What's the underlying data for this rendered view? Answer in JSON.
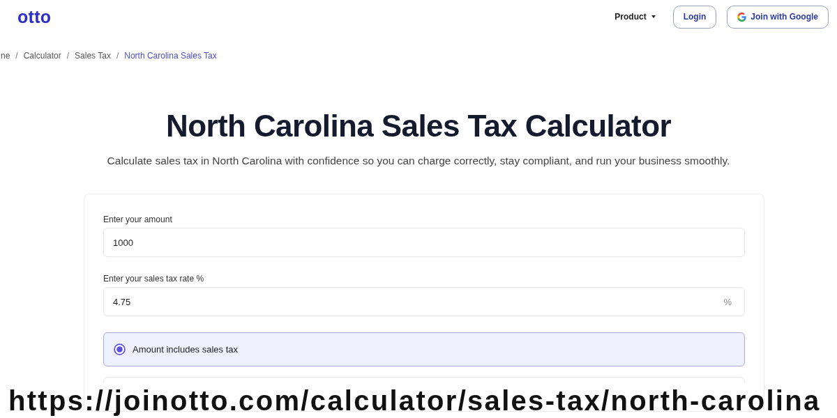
{
  "header": {
    "logo": "otto",
    "nav": [
      {
        "label": "Product",
        "kind": "dropdown"
      }
    ],
    "buttons": [
      {
        "label": "Login",
        "kind": "outline"
      },
      {
        "label": "Join with Google",
        "kind": "google"
      }
    ]
  },
  "breadcrumb": {
    "separator": "/",
    "items": [
      {
        "label": "ne",
        "current": false
      },
      {
        "label": "Calculator",
        "current": false
      },
      {
        "label": "Sales Tax",
        "current": false
      },
      {
        "label": "North Carolina Sales Tax",
        "current": true
      }
    ]
  },
  "title": "North Carolina Sales Tax Calculator",
  "subtitle": "Calculate sales tax in North Carolina with confidence so you can charge correctly, stay compliant, and run your business smoothly.",
  "form": {
    "fields": [
      {
        "label": "Enter your amount",
        "value": "1000"
      },
      {
        "label": "Enter your sales tax rate %",
        "value": "4.75",
        "suffix": "%"
      }
    ],
    "options": [
      {
        "label": "Amount includes sales tax",
        "selected": true
      },
      {
        "selected": false
      }
    ]
  },
  "caption": "https://joinotto.com/calculator/sales-tax/north-carolina"
}
